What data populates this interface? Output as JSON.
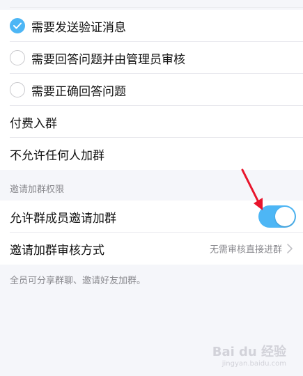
{
  "join_options": [
    {
      "label": "需要发送验证消息",
      "selected": true
    },
    {
      "label": "需要回答问题并由管理员审核",
      "selected": false
    },
    {
      "label": "需要正确回答问题",
      "selected": false
    }
  ],
  "paid_join_label": "付费入群",
  "no_one_join_label": "不允许任何人加群",
  "invite_section_title": "邀请加群权限",
  "allow_member_invite": {
    "label": "允许群成员邀请加群",
    "enabled": true
  },
  "invite_review": {
    "label": "邀请加群审核方式",
    "value": "无需审核直接进群"
  },
  "footnote": "全员可分享群聊、邀请好友加群。",
  "watermark": {
    "main": "Bai du 经验",
    "sub": "jingyan.baidu.com"
  },
  "colors": {
    "accent": "#4db6f5",
    "arrow": "#e8142b"
  }
}
